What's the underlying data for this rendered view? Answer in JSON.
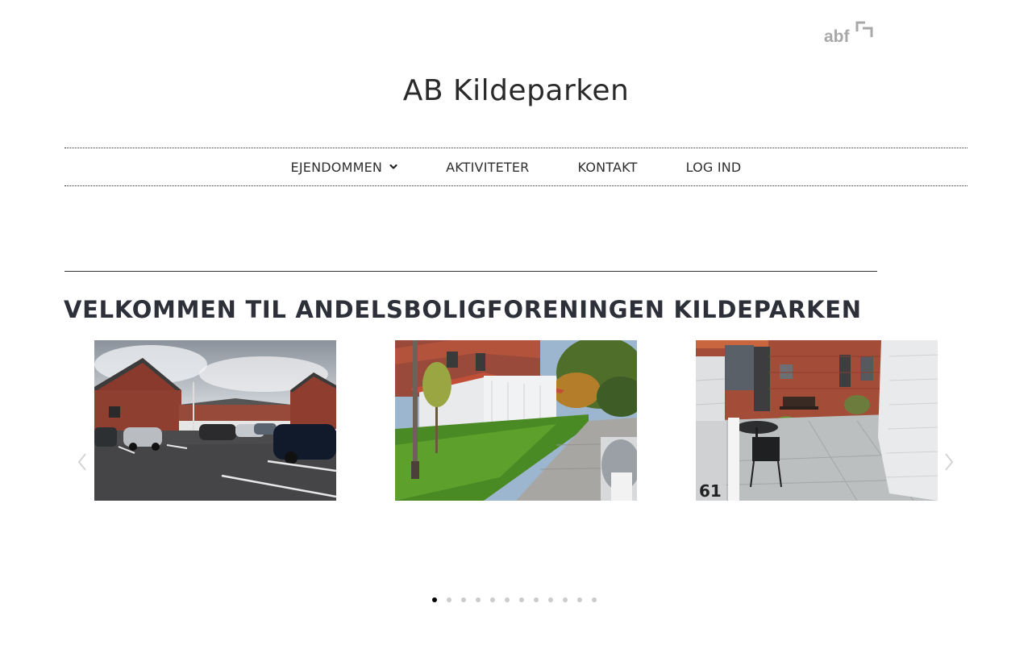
{
  "logo": {
    "text": "abf",
    "icon": "abf-logo-icon",
    "color": "#a8a8a8"
  },
  "site": {
    "title": "AB Kildeparken"
  },
  "nav": {
    "items": [
      {
        "label": "EJENDOMMEN",
        "has_dropdown": true
      },
      {
        "label": "AKTIVITETER"
      },
      {
        "label": "KONTAKT"
      },
      {
        "label": "LOG IND"
      }
    ]
  },
  "main": {
    "heading": "VELKOMMEN TIL ANDELSBOLIGFORENINGEN KILDEPARKEN"
  },
  "carousel": {
    "slides": [
      {
        "subject": "parking-lot-photo"
      },
      {
        "subject": "garden-lawn-photo"
      },
      {
        "subject": "patio-terrace-photo"
      }
    ],
    "prev_icon": "chevron-left-icon",
    "next_icon": "chevron-right-icon",
    "active_index": 0,
    "dot_count": 12
  },
  "colors": {
    "text": "#2e3039",
    "dot_active": "#000000",
    "dot_inactive": "#cccccc"
  }
}
